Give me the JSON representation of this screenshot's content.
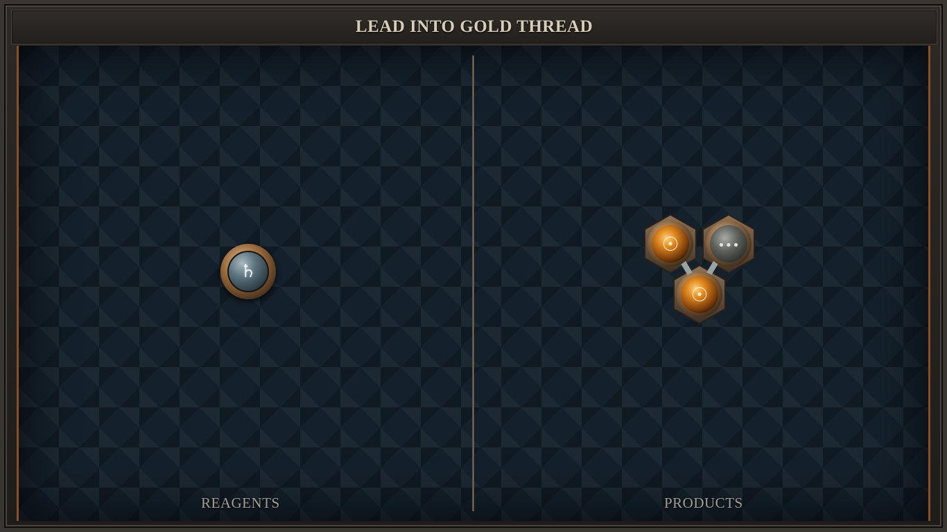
{
  "title": "LEAD INTO GOLD THREAD",
  "panels": {
    "reagents_label": "REAGENTS",
    "products_label": "PRODUCTS"
  },
  "reagent": {
    "element": "lead",
    "symbol": "♄"
  },
  "product": {
    "atoms": [
      {
        "element": "gold",
        "symbol": "☉"
      },
      {
        "element": "placeholder",
        "symbol": "•••"
      },
      {
        "element": "gold",
        "symbol": "☉"
      }
    ]
  },
  "colors": {
    "accent_copper": "#8a4f23",
    "title_text": "#d8cdb9",
    "board_bg": "#14202b",
    "gold_atom": "#d9801c",
    "lead_atom": "#59717c"
  }
}
